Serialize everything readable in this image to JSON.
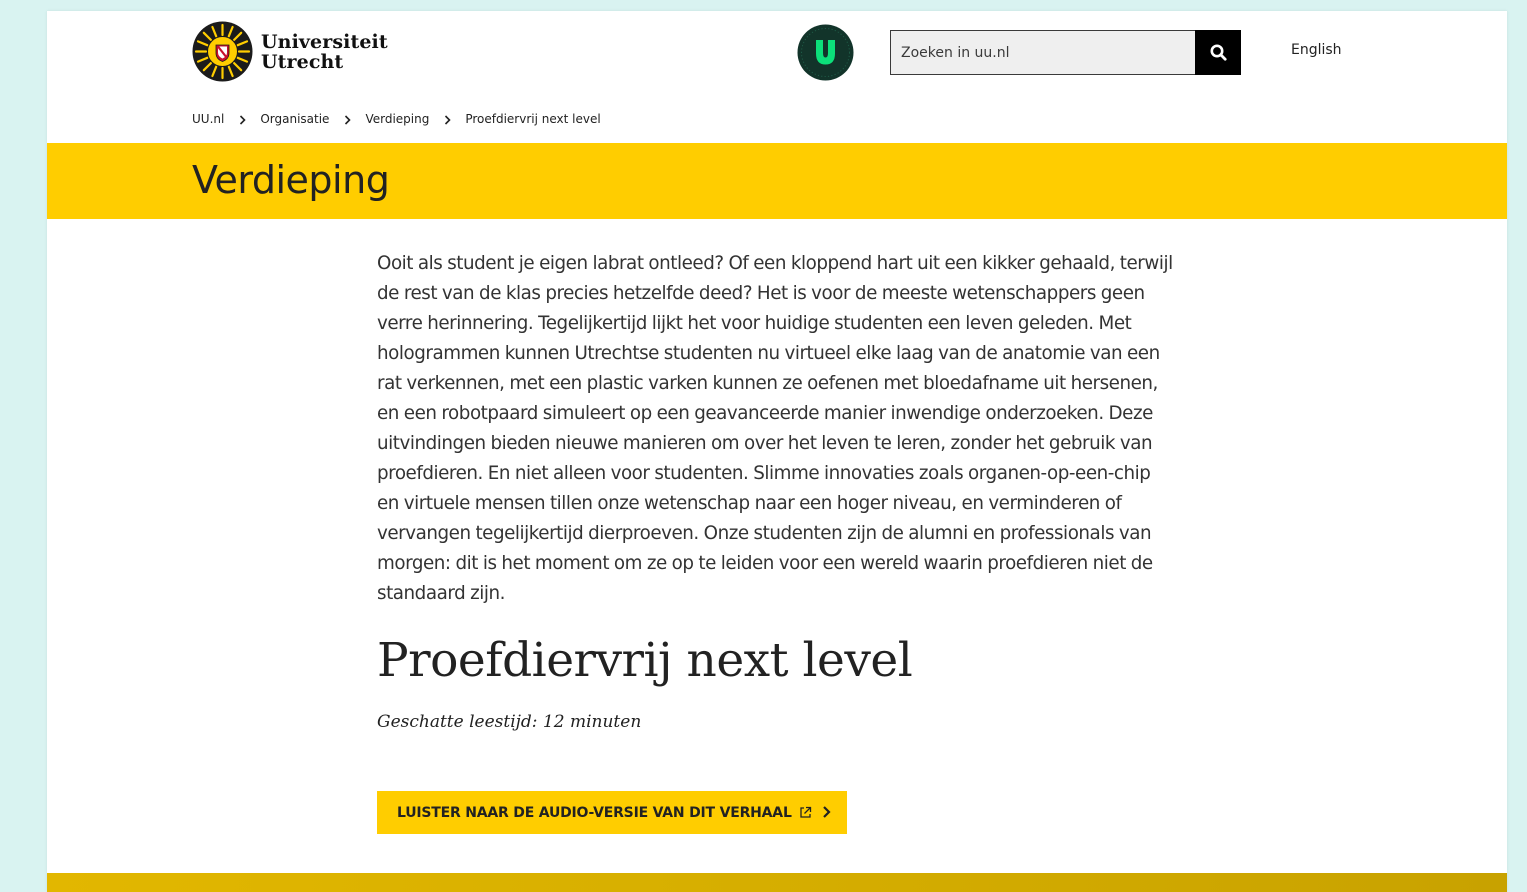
{
  "header": {
    "logo": {
      "line1": "Universiteit",
      "line2": "Utrecht"
    },
    "search": {
      "placeholder": "Zoeken in uu.nl"
    },
    "language_link": "English"
  },
  "breadcrumb": {
    "items": [
      "UU.nl",
      "Organisatie",
      "Verdieping",
      "Proefdiervrij next level"
    ]
  },
  "band": {
    "title": "Verdieping"
  },
  "article": {
    "intro": "Ooit als student je eigen labrat ontleed? Of een kloppend hart uit een kikker gehaald, terwijl de rest van de klas precies hetzelfde deed? Het is voor de meeste wetenschappers geen verre herinnering. Tegelijkertijd lijkt het voor huidige studenten een leven geleden. Met hologrammen kunnen Utrechtse studenten nu virtueel elke laag van de anatomie van een rat verkennen, met een plastic varken kunnen ze oefenen met bloedafname uit hersenen, en een robotpaard simuleert op een geavanceerde manier inwendige onderzoeken. Deze uitvindingen bieden nieuwe manieren om over het leven te leren, zonder het gebruik van proefdieren. En niet alleen voor studenten. Slimme innovaties zoals organen-op-een-chip en virtuele mensen tillen onze wetenschap naar een hoger niveau, en verminderen of vervangen tegelijkertijd dierproeven. Onze studenten zijn de alumni en professionals van morgen: dit is het moment om ze op te leiden voor een wereld waarin proefdieren niet de standaard zijn.",
    "title": "Proefdiervrij next level",
    "reading_time": "Geschatte leestijd: 12 minuten",
    "audio_button": "LUISTER NAAR DE AUDIO-VERSIE VAN DIT VERHAAL"
  },
  "colors": {
    "brand_yellow": "#ffcd00",
    "badge_green": "#0aa66a",
    "badge_ring": "#1a4d3c",
    "text": "#222222",
    "page_background": "#d9f3f1"
  },
  "icons": {
    "seal": "university-seal-icon",
    "badge": "utrecht-u-badge-icon",
    "search": "search-icon",
    "breadcrumb_separator": "chevron-right-icon",
    "external_link": "external-link-icon",
    "button_chevron": "chevron-right-icon"
  }
}
